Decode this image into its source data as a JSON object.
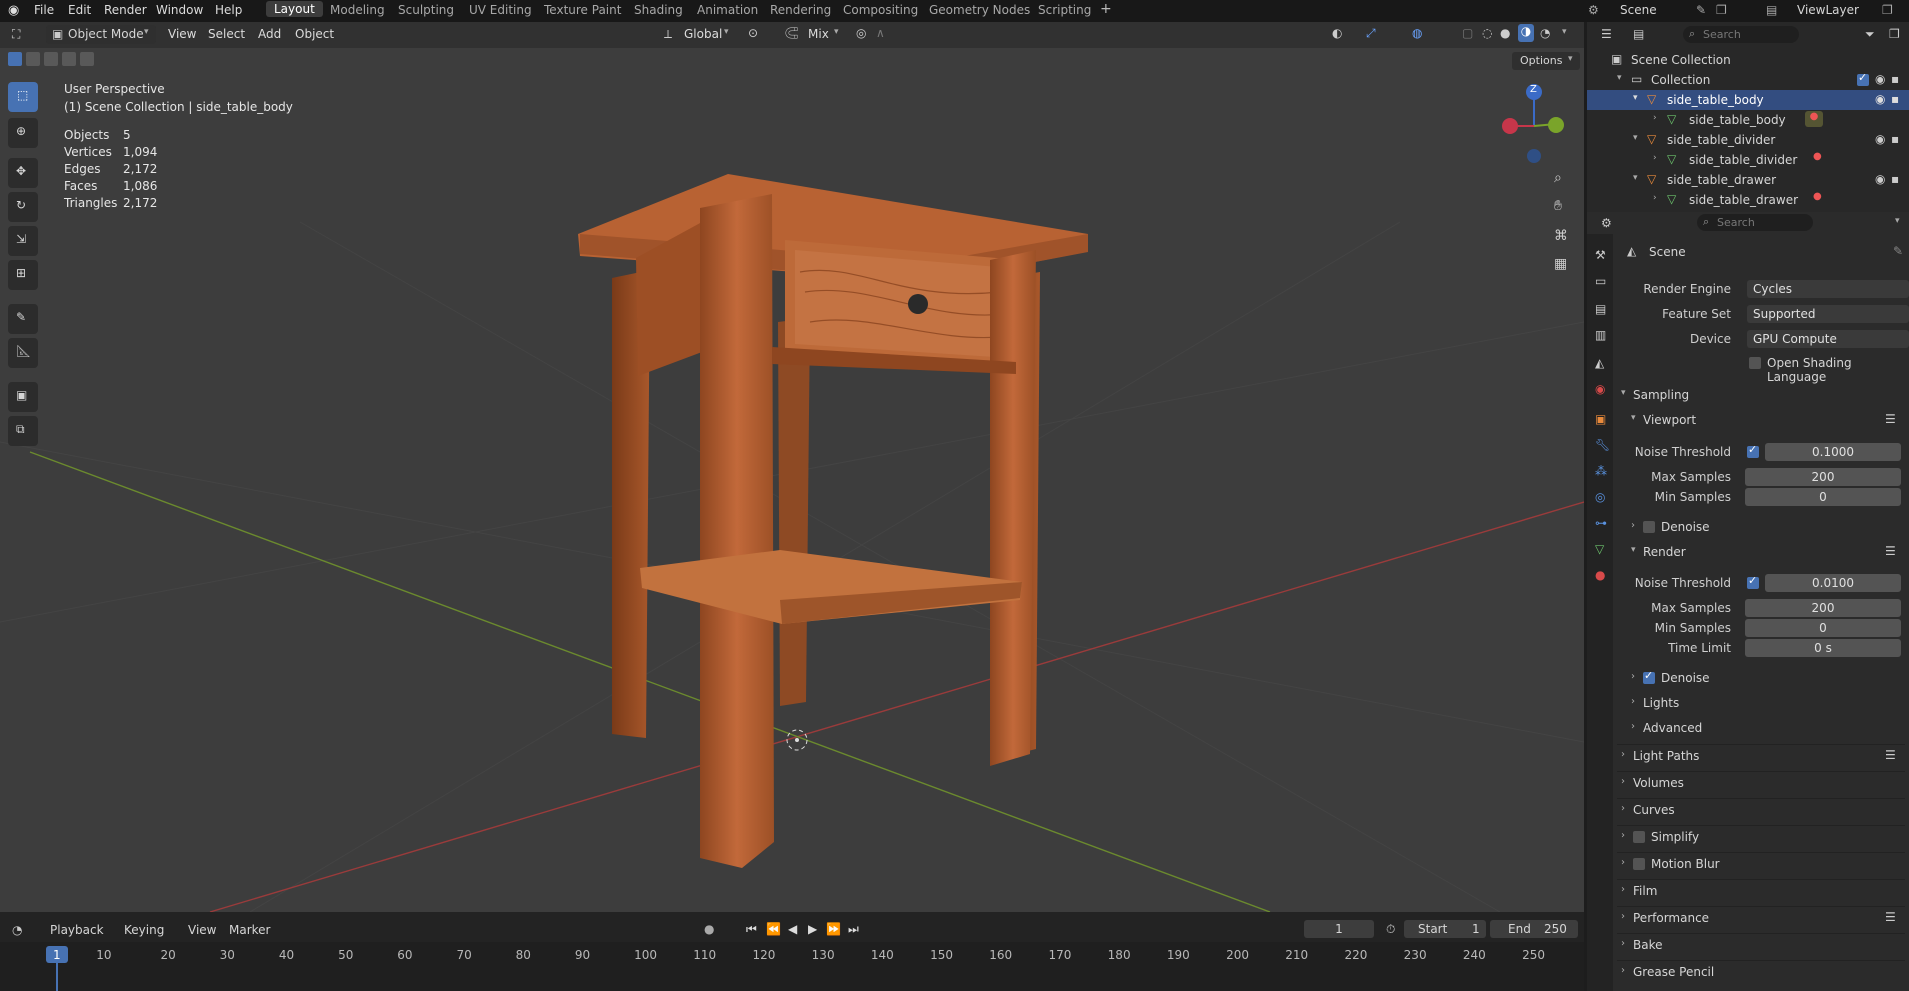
{
  "menu": {
    "items": [
      "File",
      "Edit",
      "Render",
      "Window",
      "Help"
    ]
  },
  "workspaces": [
    "Layout",
    "Modeling",
    "Sculpting",
    "UV Editing",
    "Texture Paint",
    "Shading",
    "Animation",
    "Rendering",
    "Compositing",
    "Geometry Nodes",
    "Scripting"
  ],
  "active_workspace": "Layout",
  "top_right": {
    "scene": "Scene",
    "view_layer": "ViewLayer"
  },
  "viewport": {
    "mode": "Object Mode",
    "menus": [
      "View",
      "Select",
      "Add",
      "Object"
    ],
    "transform_orientation": "Global",
    "snap_mode": "Mix",
    "options_label": "Options",
    "view_name": "User Perspective",
    "context": "(1) Scene Collection | side_table_body",
    "stats": [
      {
        "label": "Objects",
        "value": "5"
      },
      {
        "label": "Vertices",
        "value": "1,094"
      },
      {
        "label": "Edges",
        "value": "2,172"
      },
      {
        "label": "Faces",
        "value": "1,086"
      },
      {
        "label": "Triangles",
        "value": "2,172"
      }
    ],
    "gizmo": {
      "z": "Z"
    }
  },
  "timeline": {
    "menus": [
      "Playback",
      "Keying",
      "View",
      "Marker"
    ],
    "current_frame": "1",
    "start_label": "Start",
    "start": "1",
    "end_label": "End",
    "end": "250",
    "ticks": [
      "1",
      "10",
      "20",
      "30",
      "40",
      "50",
      "60",
      "70",
      "80",
      "90",
      "100",
      "110",
      "120",
      "130",
      "140",
      "150",
      "160",
      "170",
      "180",
      "190",
      "200",
      "210",
      "220",
      "230",
      "240",
      "250"
    ]
  },
  "outliner": {
    "search_placeholder": "Search",
    "root": "Scene Collection",
    "collection": "Collection",
    "rows": [
      {
        "name": "side_table_body",
        "mesh": "side_table_body"
      },
      {
        "name": "side_table_divider",
        "mesh": "side_table_divider"
      },
      {
        "name": "side_table_drawer",
        "mesh": "side_table_drawer"
      }
    ]
  },
  "properties": {
    "search_placeholder": "Search",
    "context": "Scene",
    "render_engine_label": "Render Engine",
    "render_engine": "Cycles",
    "feature_set_label": "Feature Set",
    "feature_set": "Supported",
    "device_label": "Device",
    "device": "GPU Compute",
    "osl_label": "Open Shading Language",
    "sampling": "Sampling",
    "viewport": "Viewport",
    "noise_threshold_label": "Noise Threshold",
    "vp_noise_threshold": "0.1000",
    "max_samples_label": "Max Samples",
    "vp_max_samples": "200",
    "min_samples_label": "Min Samples",
    "vp_min_samples": "0",
    "denoise_label": "Denoise",
    "render": "Render",
    "r_noise_threshold": "0.0100",
    "r_max_samples": "200",
    "r_min_samples": "0",
    "time_limit_label": "Time Limit",
    "r_time_limit": "0 s",
    "lights": "Lights",
    "advanced": "Advanced",
    "panels": [
      "Light Paths",
      "Volumes",
      "Curves",
      "Simplify",
      "Motion Blur",
      "Film",
      "Performance",
      "Bake",
      "Grease Pencil"
    ]
  },
  "colors": {
    "accent": "#4772b3",
    "selection": "#334d80",
    "viewport_bg": "#3d3d3d",
    "wood": "#b8612e"
  }
}
